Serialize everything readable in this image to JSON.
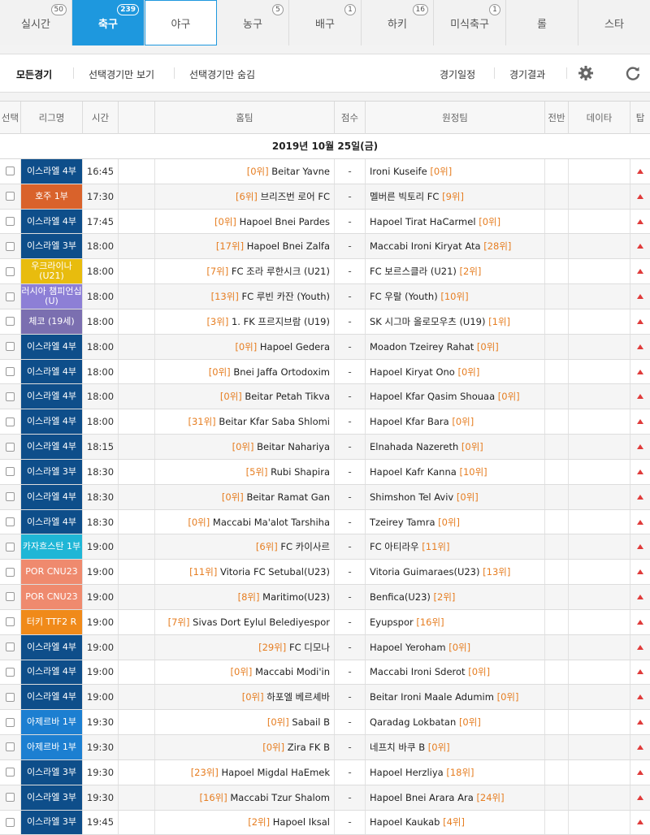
{
  "tabs": [
    {
      "label": "실시간",
      "count": "50"
    },
    {
      "label": "축구",
      "count": "239"
    },
    {
      "label": "야구",
      "count": ""
    },
    {
      "label": "농구",
      "count": "5"
    },
    {
      "label": "배구",
      "count": "1"
    },
    {
      "label": "하키",
      "count": "16"
    },
    {
      "label": "미식축구",
      "count": "1"
    },
    {
      "label": "롤",
      "count": ""
    },
    {
      "label": "스타",
      "count": ""
    }
  ],
  "filter": {
    "all": "모든경기",
    "show_selected": "선택경기만 보기",
    "hide_selected": "선택경기만 숨김",
    "schedule": "경기일정",
    "results": "경기결과"
  },
  "columns": [
    "선택",
    "리그명",
    "시간",
    "",
    "홈팀",
    "점수",
    "원정팀",
    "전반",
    "데이타",
    "탑"
  ],
  "date": "2019년 10월 25일(금)",
  "colors": {
    "accent": "#1e98de",
    "rank": "#e67e22",
    "top_arrow": "#e03a3a"
  },
  "matches": [
    {
      "league": "이스라엘 4부",
      "color": "#0e4e8a",
      "time": "16:45",
      "home_rank": "[0위]",
      "home": "Beitar Yavne",
      "score": "-",
      "away": "Ironi Kuseife",
      "away_rank": "[0위]"
    },
    {
      "league": "호주 1부",
      "color": "#d9622b",
      "time": "17:30",
      "home_rank": "[6위]",
      "home": "브리즈번 로어 FC",
      "score": "-",
      "away": "멜버른 빅토리 FC",
      "away_rank": "[9위]"
    },
    {
      "league": "이스라엘 4부",
      "color": "#0e4e8a",
      "time": "17:45",
      "home_rank": "[0위]",
      "home": "Hapoel Bnei Pardes",
      "score": "-",
      "away": "Hapoel Tirat HaCarmel",
      "away_rank": "[0위]"
    },
    {
      "league": "이스라엘 3부",
      "color": "#0e4e8a",
      "time": "18:00",
      "home_rank": "[17위]",
      "home": "Hapoel Bnei Zalfa",
      "score": "-",
      "away": "Maccabi Ironi Kiryat Ata",
      "away_rank": "[28위]"
    },
    {
      "league": "우크라이나(U21)",
      "color": "#e8bc0e",
      "time": "18:00",
      "home_rank": "[7위]",
      "home": "FC 조라 루한시크 (U21)",
      "score": "-",
      "away": "FC 보르스클라 (U21)",
      "away_rank": "[2위]"
    },
    {
      "league": "러시아 챔피언십 (U)",
      "color": "#8d7fd6",
      "time": "18:00",
      "home_rank": "[13위]",
      "home": "FC 루빈 카잔 (Youth)",
      "score": "-",
      "away": "FC 우랄 (Youth)",
      "away_rank": "[10위]"
    },
    {
      "league": "체코 (19세)",
      "color": "#7b6fb0",
      "time": "18:00",
      "home_rank": "[3위]",
      "home": "1. FK 프르지브람 (U19)",
      "score": "-",
      "away": "SK 시그마 올로모우츠 (U19)",
      "away_rank": "[1위]"
    },
    {
      "league": "이스라엘 4부",
      "color": "#0e4e8a",
      "time": "18:00",
      "home_rank": "[0위]",
      "home": "Hapoel Gedera",
      "score": "-",
      "away": "Moadon Tzeirey Rahat",
      "away_rank": "[0위]"
    },
    {
      "league": "이스라엘 4부",
      "color": "#0e4e8a",
      "time": "18:00",
      "home_rank": "[0위]",
      "home": "Bnei Jaffa Ortodoxim",
      "score": "-",
      "away": "Hapoel Kiryat Ono",
      "away_rank": "[0위]"
    },
    {
      "league": "이스라엘 4부",
      "color": "#0e4e8a",
      "time": "18:00",
      "home_rank": "[0위]",
      "home": "Beitar Petah Tikva",
      "score": "-",
      "away": "Hapoel Kfar Qasim Shouaa",
      "away_rank": "[0위]"
    },
    {
      "league": "이스라엘 4부",
      "color": "#0e4e8a",
      "time": "18:00",
      "home_rank": "[31위]",
      "home": "Beitar Kfar Saba Shlomi",
      "score": "-",
      "away": "Hapoel Kfar Bara",
      "away_rank": "[0위]"
    },
    {
      "league": "이스라엘 4부",
      "color": "#0e4e8a",
      "time": "18:15",
      "home_rank": "[0위]",
      "home": "Beitar Nahariya",
      "score": "-",
      "away": "Elnahada Nazereth",
      "away_rank": "[0위]"
    },
    {
      "league": "이스라엘 3부",
      "color": "#0e4e8a",
      "time": "18:30",
      "home_rank": "[5위]",
      "home": "Rubi Shapira",
      "score": "-",
      "away": "Hapoel Kafr Kanna",
      "away_rank": "[10위]"
    },
    {
      "league": "이스라엘 4부",
      "color": "#0e4e8a",
      "time": "18:30",
      "home_rank": "[0위]",
      "home": "Beitar Ramat Gan",
      "score": "-",
      "away": "Shimshon Tel Aviv",
      "away_rank": "[0위]"
    },
    {
      "league": "이스라엘 4부",
      "color": "#0e4e8a",
      "time": "18:30",
      "home_rank": "[0위]",
      "home": "Maccabi Ma'alot Tarshiha",
      "score": "-",
      "away": "Tzeirey Tamra",
      "away_rank": "[0위]"
    },
    {
      "league": "카자흐스탄 1부",
      "color": "#1fb6d6",
      "time": "19:00",
      "home_rank": "[6위]",
      "home": "FC 카이사르",
      "score": "-",
      "away": "FC 아티라우",
      "away_rank": "[11위]"
    },
    {
      "league": "POR CNU23",
      "color": "#ef8a6e",
      "time": "19:00",
      "home_rank": "[11위]",
      "home": "Vitoria FC Setubal(U23)",
      "score": "-",
      "away": "Vitoria Guimaraes(U23)",
      "away_rank": "[13위]"
    },
    {
      "league": "POR CNU23",
      "color": "#ef8a6e",
      "time": "19:00",
      "home_rank": "[8위]",
      "home": "Maritimo(U23)",
      "score": "-",
      "away": "Benfica(U23)",
      "away_rank": "[2위]"
    },
    {
      "league": "터키 TTF2 R",
      "color": "#f08a1a",
      "time": "19:00",
      "home_rank": "[7위]",
      "home": "Sivas Dort Eylul Belediyespor",
      "score": "-",
      "away": "Eyupspor",
      "away_rank": "[16위]"
    },
    {
      "league": "이스라엘 4부",
      "color": "#0e4e8a",
      "time": "19:00",
      "home_rank": "[29위]",
      "home": "FC 디모나",
      "score": "-",
      "away": "Hapoel Yeroham",
      "away_rank": "[0위]"
    },
    {
      "league": "이스라엘 4부",
      "color": "#0e4e8a",
      "time": "19:00",
      "home_rank": "[0위]",
      "home": "Maccabi Modi'in",
      "score": "-",
      "away": "Maccabi Ironi Sderot",
      "away_rank": "[0위]"
    },
    {
      "league": "이스라엘 4부",
      "color": "#0e4e8a",
      "time": "19:00",
      "home_rank": "[0위]",
      "home": "하포엘 베르셰바",
      "score": "-",
      "away": "Beitar Ironi Maale Adumim",
      "away_rank": "[0위]"
    },
    {
      "league": "아제르바 1부",
      "color": "#1c7fd1",
      "time": "19:30",
      "home_rank": "[0위]",
      "home": "Sabail B",
      "score": "-",
      "away": "Qaradag Lokbatan",
      "away_rank": "[0위]"
    },
    {
      "league": "아제르바 1부",
      "color": "#1c7fd1",
      "time": "19:30",
      "home_rank": "[0위]",
      "home": "Zira FK B",
      "score": "-",
      "away": "네프치 바쿠 B",
      "away_rank": "[0위]"
    },
    {
      "league": "이스라엘 3부",
      "color": "#0e4e8a",
      "time": "19:30",
      "home_rank": "[23위]",
      "home": "Hapoel Migdal HaEmek",
      "score": "-",
      "away": "Hapoel Herzliya",
      "away_rank": "[18위]"
    },
    {
      "league": "이스라엘 3부",
      "color": "#0e4e8a",
      "time": "19:30",
      "home_rank": "[16위]",
      "home": "Maccabi Tzur Shalom",
      "score": "-",
      "away": "Hapoel Bnei Arara Ara",
      "away_rank": "[24위]"
    },
    {
      "league": "이스라엘 3부",
      "color": "#0e4e8a",
      "time": "19:45",
      "home_rank": "[2위]",
      "home": "Hapoel Iksal",
      "score": "-",
      "away": "Hapoel Kaukab",
      "away_rank": "[4위]"
    }
  ]
}
